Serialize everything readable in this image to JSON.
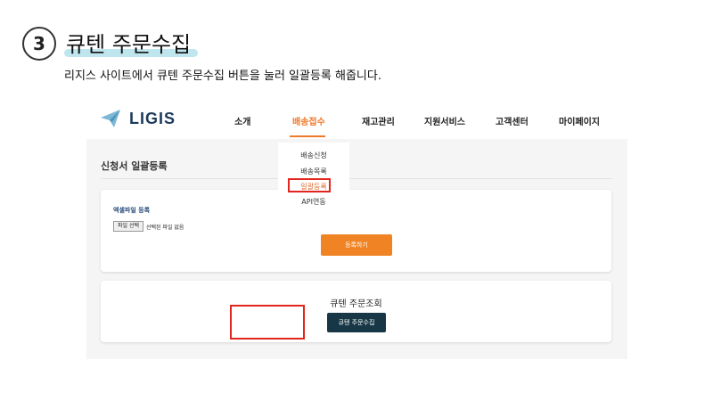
{
  "step": {
    "number": "3",
    "title": "큐텐 주문수집",
    "description": "리지스 사이트에서 큐텐 주문수집 버튼을 눌러 일괄등록 해줍니다."
  },
  "app": {
    "logo_text": "LIGIS",
    "nav": [
      "소개",
      "배송접수",
      "재고관리",
      "지원서비스",
      "고객센터",
      "마이페이지"
    ],
    "active_nav": "배송접수",
    "dropdown": [
      "배송신청",
      "배송목록",
      "일괄등록",
      "API연동"
    ],
    "dropdown_selected": "일괄등록",
    "section_title": "신청서 일괄등록",
    "upload": {
      "label": "엑셀파일 등록",
      "file_button": "파일 선택",
      "file_status": "선택된 파일 없음",
      "register_button": "등록하기"
    },
    "query": {
      "title": "큐텐 주문조회",
      "collect_button": "큐텐 주문수집"
    }
  },
  "colors": {
    "accent": "#ee7a2a",
    "highlight": "#e2261e",
    "logo": "#1d3a5c",
    "dark_button": "#173746"
  }
}
